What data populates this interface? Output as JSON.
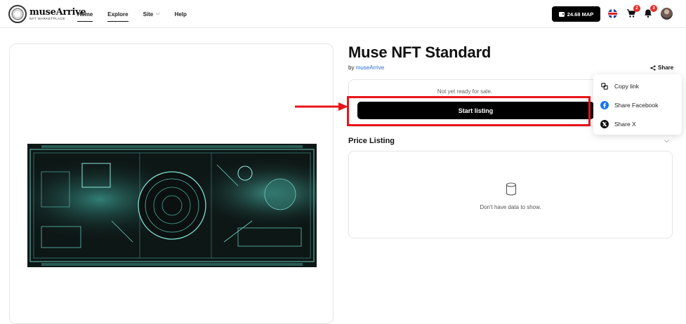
{
  "header": {
    "logo_name": "museArrive",
    "logo_sub": "NFT MARKETPLACE",
    "nav": [
      {
        "label": "Home"
      },
      {
        "label": "Explore"
      },
      {
        "label": "Site"
      },
      {
        "label": "Help"
      }
    ],
    "wallet_balance": "24.68 MAP",
    "cart_count": "2",
    "notification_count": "3"
  },
  "nft": {
    "title": "Muse NFT Standard",
    "by_prefix": "by",
    "creator": "museArrive",
    "share_label": "Share",
    "sale_status": "Not yet ready for sale.",
    "start_listing_label": "Start listing"
  },
  "share_menu": {
    "items": [
      {
        "label": "Copy link",
        "icon": "copy-link-icon"
      },
      {
        "label": "Share Facebook",
        "icon": "facebook-icon"
      },
      {
        "label": "Share X",
        "icon": "x-icon"
      }
    ]
  },
  "price_listing": {
    "title": "Price Listing",
    "empty_text": "Don't have data to show."
  },
  "colors": {
    "link": "#2a6fd6",
    "highlight": "#e8141a",
    "badge": "#e5302a"
  }
}
